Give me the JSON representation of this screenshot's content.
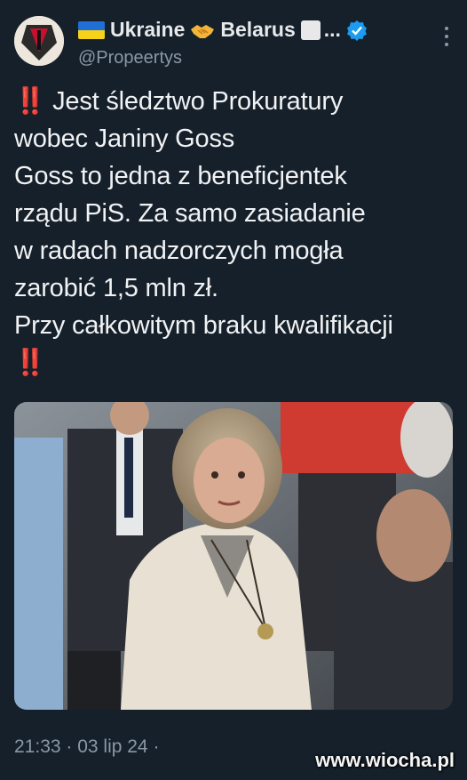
{
  "account": {
    "name_part1": "Ukraine",
    "name_part2": "Belarus",
    "name_ellipsis": "...",
    "handle": "@Propeertys",
    "icons": [
      "avatar",
      "ukraine-flag-icon",
      "handshake-icon",
      "white-square-icon",
      "verified-icon",
      "more-icon"
    ]
  },
  "tweet": {
    "emoji": "‼️",
    "lines": [
      "Jest śledztwo Prokuratury",
      "wobec Janiny Goss",
      "Goss to jedna z beneficjentek",
      "rządu PiS. Za samo zasiadanie",
      "w radach nadzorczych mogła",
      "zarobić 1,5 mln zł.",
      "Przy całkowitym braku kwalifikacji"
    ]
  },
  "footer": {
    "timestamp": "21:33 · 03 lip 24 ·"
  },
  "watermark": "www.wiocha.pl",
  "colors": {
    "background": "#15202b",
    "text": "#e7e9ea",
    "muted": "#8b98a5",
    "accent_verified": "#1d9bf0",
    "bang": "#ff2a2a"
  }
}
